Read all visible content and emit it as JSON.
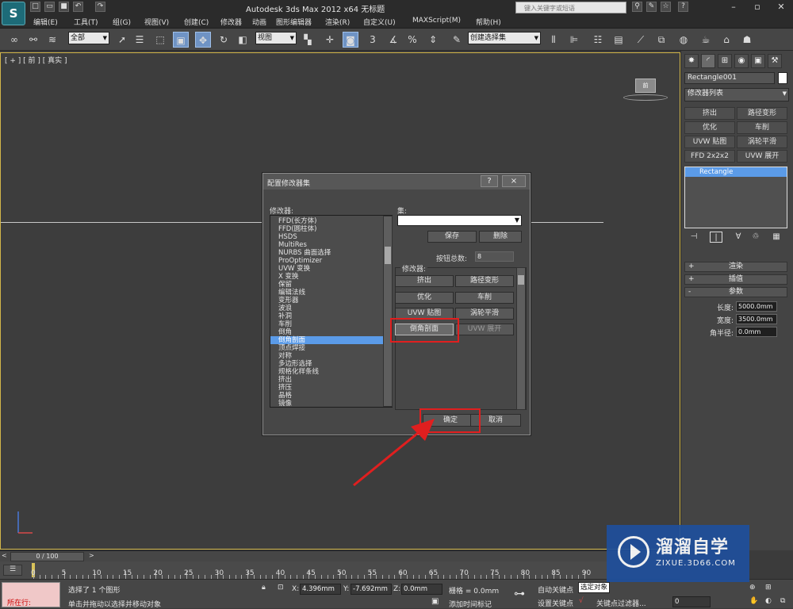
{
  "titlebar": {
    "app_title": "Autodesk 3ds Max  2012 x64    无标题",
    "search_placeholder": "键入关键字或短语"
  },
  "menubar": {
    "items": [
      "编辑(E)",
      "工具(T)",
      "组(G)",
      "视图(V)",
      "创建(C)",
      "修改器",
      "动画",
      "图形编辑器",
      "渲染(R)",
      "自定义(U)",
      "MAXScript(M)",
      "帮助(H)"
    ]
  },
  "toolbar": {
    "selection_filter": "全部",
    "ref_coord": "视图",
    "named_selection": "创建选择集",
    "snap_label": "3"
  },
  "viewport": {
    "label": "[ + ] [ 前 ] [ 真实 ]",
    "viewcube_label": "前"
  },
  "command_panel": {
    "object_name": "Rectangle001",
    "modifier_list": "修改器列表",
    "mod_buttons": [
      "挤出",
      "路径变形",
      "优化",
      "车削",
      "UVW 贴图",
      "涡轮平滑",
      "FFD 2x2x2",
      "UVW 展开"
    ],
    "stack_item": "Rectangle",
    "rollouts": {
      "render": "渲染",
      "interp": "插值",
      "params": "参数"
    },
    "params": {
      "length_label": "长度:",
      "length": "5000.0mm",
      "width_label": "宽度:",
      "width": "3500.0mm",
      "radius_label": "角半径:",
      "radius": "0.0mm"
    }
  },
  "dialog": {
    "title": "配置修改器集",
    "help": "?",
    "close": "×",
    "modifiers_label": "修改器:",
    "list": [
      "FFD(长方体)",
      "FFD(圆柱体)",
      "HSDS",
      "MultiRes",
      "NURBS 曲面选择",
      "ProOptimizer",
      "UVW 变换",
      "X 变换",
      "保留",
      "编辑法线",
      "变形器",
      "波浪",
      "补洞",
      "车削",
      "倒角",
      "倒角剖面",
      "顶点焊接",
      "对称",
      "多边形选择",
      "规格化样条线",
      "挤出",
      "挤压",
      "晶格",
      "镜像"
    ],
    "selected_index": 15,
    "sets_label": "集:",
    "save": "保存",
    "delete": "删除",
    "button_total_label": "按钮总数:",
    "button_total": "8",
    "group_label": "修改器:",
    "grid_buttons": [
      "挤出",
      "路径变形",
      "优化",
      "车削",
      "UVW 贴图",
      "涡轮平滑",
      "倒角剖面",
      "UVW 展开"
    ],
    "ok": "确定",
    "cancel": "取消"
  },
  "timeline": {
    "slider": "0 / 100",
    "ticks": [
      "0",
      "5",
      "10",
      "15",
      "20",
      "25",
      "30",
      "35",
      "40",
      "45",
      "50",
      "55",
      "60",
      "65",
      "70",
      "75",
      "80",
      "85",
      "90"
    ]
  },
  "status": {
    "location": "所在行:",
    "message1": "选择了 1 个图形",
    "message2": "单击并拖动以选择并移动对象",
    "x_label": "X:",
    "x": "4.396mm",
    "y_label": "Y:",
    "y": "-7.692mm",
    "z_label": "Z:",
    "z": "0.0mm",
    "grid": "栅格 = 0.0mm",
    "add_time_tag": "添加时间标记",
    "auto_key": "自动关键点",
    "selected_obj": "选定对象",
    "set_key": "设置关键点",
    "key_filter": "关键点过滤器...",
    "frame": "0"
  },
  "watermark": {
    "title": "溜溜自学",
    "url": "ZIXUE.3D66.COM"
  },
  "colors": {
    "highlight": "#5b9be8",
    "annotation_red": "#e01f1f",
    "viewport_border": "#d2b64a",
    "watermark_bg": "#1f4f9c"
  }
}
